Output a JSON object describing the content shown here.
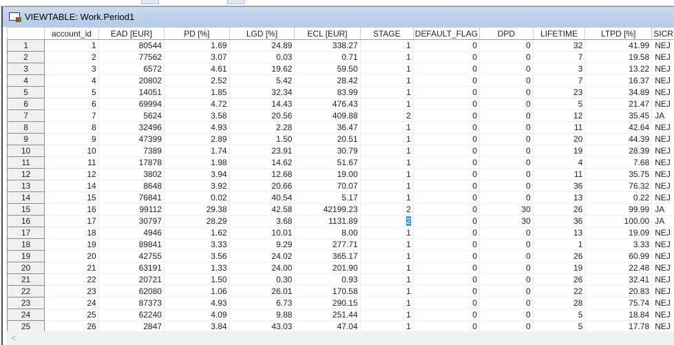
{
  "window": {
    "title": "VIEWTABLE: Work.Period1"
  },
  "columns": [
    "",
    "account_id",
    "EAD [EUR]",
    "PD [%]",
    "LGD [%]",
    "ECL [EUR]",
    "STAGE",
    "DEFAULT_FLAG",
    "DPD",
    "LIFETIME",
    "LTPD [%]",
    "SICR"
  ],
  "rows": [
    [
      "1",
      "1",
      "80544",
      "1.69",
      "24.89",
      "338.27",
      "1",
      "0",
      "0",
      "32",
      "41.99",
      "NEJ"
    ],
    [
      "2",
      "2",
      "77562",
      "3.07",
      "0.03",
      "0.71",
      "1",
      "0",
      "0",
      "7",
      "19.58",
      "NEJ"
    ],
    [
      "3",
      "3",
      "6572",
      "4.61",
      "19.62",
      "59.50",
      "1",
      "0",
      "0",
      "3",
      "13.22",
      "NEJ"
    ],
    [
      "4",
      "4",
      "20802",
      "2.52",
      "5.42",
      "28.42",
      "1",
      "0",
      "0",
      "7",
      "16.37",
      "NEJ"
    ],
    [
      "5",
      "5",
      "14051",
      "1.85",
      "32.34",
      "83.99",
      "1",
      "0",
      "0",
      "23",
      "34.89",
      "NEJ"
    ],
    [
      "6",
      "6",
      "69994",
      "4.72",
      "14.43",
      "476.43",
      "1",
      "0",
      "0",
      "5",
      "21.47",
      "NEJ"
    ],
    [
      "7",
      "7",
      "5624",
      "3.58",
      "20.56",
      "409.88",
      "2",
      "0",
      "0",
      "12",
      "35.45",
      "JA"
    ],
    [
      "8",
      "8",
      "32496",
      "4.93",
      "2.28",
      "36.47",
      "1",
      "0",
      "0",
      "11",
      "42.64",
      "NEJ"
    ],
    [
      "9",
      "9",
      "47399",
      "2.89",
      "1.50",
      "20.51",
      "1",
      "0",
      "0",
      "20",
      "44.39",
      "NEJ"
    ],
    [
      "10",
      "10",
      "7389",
      "1.74",
      "23.91",
      "30.79",
      "1",
      "0",
      "0",
      "19",
      "28.39",
      "NEJ"
    ],
    [
      "11",
      "11",
      "17878",
      "1.98",
      "14.62",
      "51.67",
      "1",
      "0",
      "0",
      "4",
      "7.68",
      "NEJ"
    ],
    [
      "12",
      "12",
      "3802",
      "3.94",
      "12.68",
      "19.00",
      "1",
      "0",
      "0",
      "11",
      "35.75",
      "NEJ"
    ],
    [
      "13",
      "14",
      "8648",
      "3.92",
      "20.66",
      "70.07",
      "1",
      "0",
      "0",
      "36",
      "76.32",
      "NEJ"
    ],
    [
      "14",
      "15",
      "76841",
      "0.02",
      "40.54",
      "5.17",
      "1",
      "0",
      "0",
      "13",
      "0.22",
      "NEJ"
    ],
    [
      "15",
      "16",
      "99112",
      "29.38",
      "42.58",
      "42199.23",
      "2",
      "0",
      "30",
      "26",
      "99.99",
      "JA"
    ],
    [
      "16",
      "17",
      "30797",
      "28.29",
      "3.68",
      "1131.89",
      "2",
      "0",
      "30",
      "36",
      "100.00",
      "JA"
    ],
    [
      "17",
      "18",
      "4946",
      "1.62",
      "10.01",
      "8.00",
      "1",
      "0",
      "0",
      "13",
      "19.09",
      "NEJ"
    ],
    [
      "18",
      "19",
      "89841",
      "3.33",
      "9.29",
      "277.71",
      "1",
      "0",
      "0",
      "1",
      "3.33",
      "NEJ"
    ],
    [
      "19",
      "20",
      "42755",
      "3.56",
      "24.02",
      "365.17",
      "1",
      "0",
      "0",
      "26",
      "60.99",
      "NEJ"
    ],
    [
      "20",
      "21",
      "63191",
      "1.33",
      "24.00",
      "201.90",
      "1",
      "0",
      "0",
      "19",
      "22.48",
      "NEJ"
    ],
    [
      "21",
      "22",
      "20721",
      "1.50",
      "0.30",
      "0.93",
      "1",
      "0",
      "0",
      "26",
      "32.41",
      "NEJ"
    ],
    [
      "22",
      "23",
      "62080",
      "1.06",
      "26.01",
      "170.58",
      "1",
      "0",
      "0",
      "22",
      "20.83",
      "NEJ"
    ],
    [
      "23",
      "24",
      "87373",
      "4.93",
      "6.73",
      "290.15",
      "1",
      "0",
      "0",
      "28",
      "75.74",
      "NEJ"
    ],
    [
      "24",
      "25",
      "62240",
      "4.09",
      "9.88",
      "251.44",
      "1",
      "0",
      "0",
      "5",
      "18.84",
      "NEJ"
    ],
    [
      "25",
      "26",
      "2847",
      "3.84",
      "43.03",
      "47.04",
      "1",
      "0",
      "0",
      "5",
      "17.78",
      "NEJ"
    ]
  ],
  "selected_cell": {
    "row": 15,
    "col": 6
  },
  "scrollbar": {
    "left_arrow": "<"
  }
}
